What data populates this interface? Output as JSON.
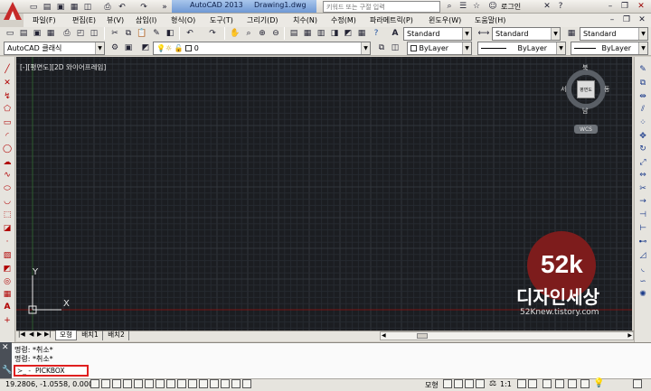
{
  "title": {
    "app": "AutoCAD 2013",
    "file": "Drawing1.dwg",
    "search_placeholder": "키워드 또는 구절 입력",
    "login": "로그인"
  },
  "menu": [
    "파일(F)",
    "편집(E)",
    "뷰(V)",
    "삽입(I)",
    "형식(O)",
    "도구(T)",
    "그리기(D)",
    "치수(N)",
    "수정(M)",
    "파라메트릭(P)",
    "윈도우(W)",
    "도움말(H)"
  ],
  "toolbar": {
    "textstyle": "Standard",
    "dimstyle": "Standard",
    "tablestyle": "Standard",
    "workspace": "AutoCAD 클래식",
    "layer": "0",
    "color": "ByLayer",
    "linetype": "ByLayer",
    "lineweight": "ByLayer"
  },
  "viewport": {
    "label": "[-][평면도][2D 와이어프레임]",
    "axis_y": "Y",
    "axis_x": "X"
  },
  "viewcube": {
    "north": "북",
    "south": "남",
    "west": "서",
    "east": "동",
    "top": "평면도",
    "wcs": "WCS"
  },
  "watermark": {
    "number": "52k",
    "name": "디자인세상",
    "url": "52Knew.tistory.com"
  },
  "tabs": [
    "모형",
    "배치1",
    "배치2"
  ],
  "command": {
    "history": [
      "명령: *취소*",
      "명령: *취소*"
    ],
    "prompt": "PICKBOX",
    "prompt_prefix": "≻_ -"
  },
  "status": {
    "coords": "19.2806, -1.0558, 0.0000",
    "model": "모형",
    "scale": "1:1"
  },
  "colors": {
    "canvas": "#1b1d21",
    "grid_minor": "#262a30",
    "grid_major": "#30353c",
    "red_line": "#7a1414",
    "highlight": "#e02020"
  }
}
